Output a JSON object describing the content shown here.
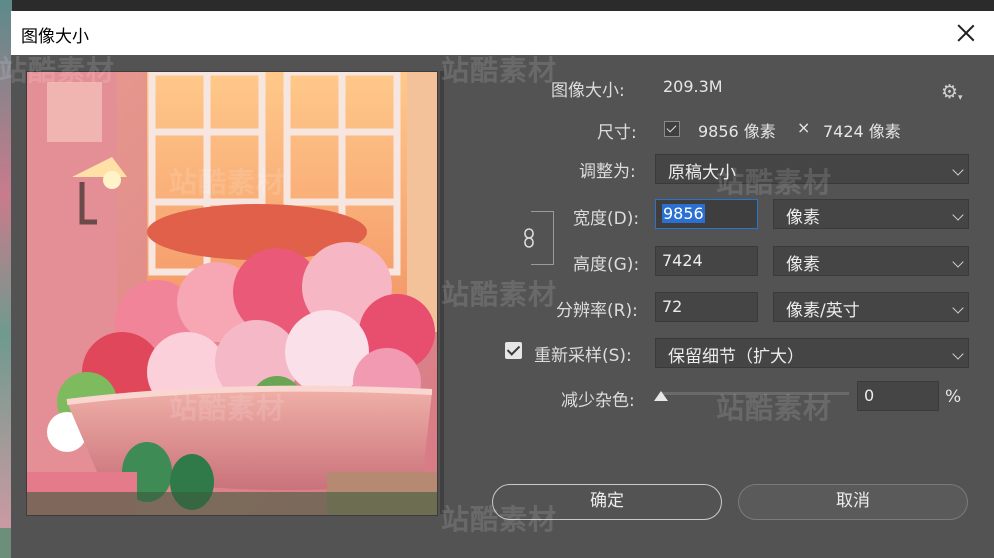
{
  "window": {
    "title": "图像大小"
  },
  "image_size": {
    "label": "图像大小:",
    "value": "209.3M"
  },
  "dimensions": {
    "label": "尺寸:",
    "width": "9856 像素",
    "times": "×",
    "height": "7424 像素"
  },
  "fit_to": {
    "label": "调整为:",
    "value": "原稿大小"
  },
  "width": {
    "label": "宽度(D):",
    "value": "9856",
    "unit": "像素"
  },
  "height": {
    "label": "高度(G):",
    "value": "7424",
    "unit": "像素"
  },
  "resolution": {
    "label": "分辨率(R):",
    "value": "72",
    "unit": "像素/英寸"
  },
  "resample": {
    "label": "重新采样(S):",
    "checked": true,
    "method": "保留细节（扩大）"
  },
  "noise": {
    "label": "减少杂色:",
    "value": "0",
    "unit": "%",
    "level": 0
  },
  "buttons": {
    "ok": "确定",
    "cancel": "取消"
  },
  "watermark": {
    "text": "站酷素材"
  },
  "colors": {
    "dialog_bg": "#535353",
    "field_bg": "#454545",
    "focus": "#2a74c9",
    "selection": "#2a6fd1"
  }
}
